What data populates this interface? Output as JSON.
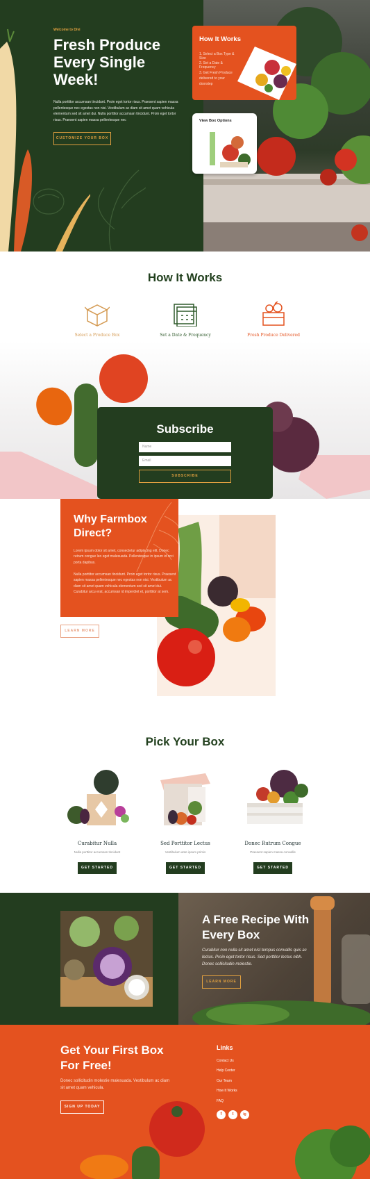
{
  "hero": {
    "eyebrow": "Welcome to Divi",
    "title": "Fresh Produce Every Single Week!",
    "text": "Nulla porttitor accumsan tincidunt. Proin eget tortor risus. Praesent sapien massa pellentesque nec egestas non nisi. Vestibulum ac diam sit amet quam vehicula elementum sed sit amet dui. Nulla porttitor accumsan tincidunt. Proin eget tortor risus. Praesent sapien massa pellentesque nec",
    "cta": "CUSTOMIZE YOUR BOX",
    "how_card": {
      "title": "How It Works",
      "steps": [
        "1. Select a Box Type & Size",
        "2. Set a Date & Frequency",
        "3. Get Fresh Produce delivered to your doorstep"
      ]
    },
    "options_card": {
      "title": "View Box Options"
    }
  },
  "how": {
    "title": "How It Works",
    "steps": [
      {
        "label": "Select a Produce Box",
        "icon": "box-icon",
        "color": "#d49a52"
      },
      {
        "label": "Set a Date & Frequency",
        "icon": "calendar-icon",
        "color": "#2f5a2b"
      },
      {
        "label": "Fresh Produce Delivered",
        "icon": "crate-icon",
        "color": "#e4521f"
      }
    ]
  },
  "subscribe": {
    "title": "Subscribe",
    "name_placeholder": "Name",
    "email_placeholder": "Email",
    "button": "SUBSCRIBE"
  },
  "why": {
    "title": "Why Farmbox Direct?",
    "para1": "Lorem ipsum dolor sit amet, consectetur adipiscing elit. Donec rutrum congue leo eget malesuada. Pellentesque in ipsum id orci porta dapibus.",
    "para2": "Nulla porttitor accumsan tincidunt. Proin eget tortor risus. Praesent sapien massa pellentesque nec egestas non nisi. Vestibulum ac diam sit amet quam vehicula elementum sed sit amet dui. Curabitur arcu erat, accumsan id imperdiet et, porttitor at sem.",
    "button": "LEARN MORE"
  },
  "boxes": {
    "title": "Pick Your Box",
    "items": [
      {
        "name": "Curabitur Nulla",
        "sub": "Nulla porttitor accumsan tincidunt",
        "button": "GET STARTED"
      },
      {
        "name": "Sed Porttitor Lectus",
        "sub": "Vestibulum ante ipsum primis",
        "button": "GET STARTED"
      },
      {
        "name": "Donec Rutrum Congue",
        "sub": "Praesent sapien massa convallis",
        "button": "GET STARTED"
      }
    ]
  },
  "recipe": {
    "title": "A Free Recipe With Every Box",
    "text": "Curabitur non nulla sit amet nisl tempus convallis quis ac lectus. Proin eget tortor risus. Sed porttitor lectus nibh. Donec sollicitudin molestie.",
    "button": "LEARN MORE"
  },
  "footer": {
    "title": "Get Your First Box For Free!",
    "text": "Donec sollicitudin molestie malesuada. Vestibulum ac diam sit amet quam vehicula.",
    "button": "SIGN UP TODAY",
    "links_title": "Links",
    "links": [
      "Contact Us",
      "Help Center",
      "Our Team",
      "How It Works",
      "FAQ"
    ],
    "social": [
      "f",
      "t",
      "ig"
    ]
  },
  "colors": {
    "green": "#233d1f",
    "orange": "#e4521f",
    "gold": "#e1a03f"
  }
}
